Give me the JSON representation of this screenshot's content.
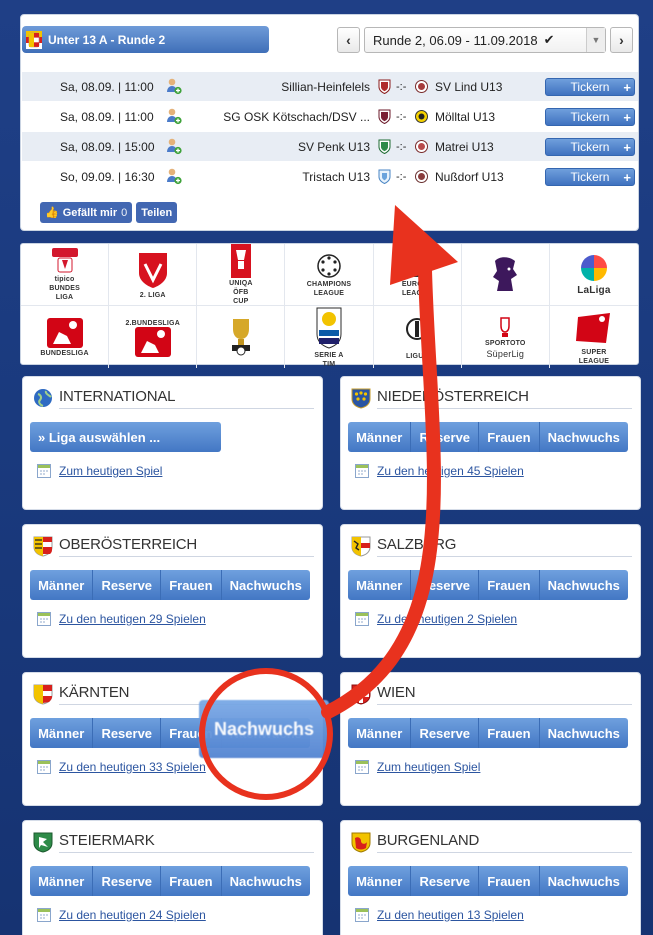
{
  "match_panel": {
    "league_title": "Unter 13 A - Runde 2",
    "round_label": "Runde 2, 06.09 - 11.09.2018",
    "prev_label": "‹",
    "next_label": "›",
    "matches": [
      {
        "date": "Sa, 08.09. | 11:00",
        "home": "Sillian-Heinfelels",
        "score": "-:-",
        "away": "SV Lind U13",
        "ticker": "Tickern"
      },
      {
        "date": "Sa, 08.09. | 11:00",
        "home": "SG OSK Kötschach/DSV ...",
        "score": "-:-",
        "away": "Mölltal U13",
        "ticker": "Tickern"
      },
      {
        "date": "Sa, 08.09. | 15:00",
        "home": "SV Penk U13",
        "score": "-:-",
        "away": "Matrei U13",
        "ticker": "Tickern"
      },
      {
        "date": "So, 09.09. | 16:30",
        "home": "Tristach U13",
        "score": "-:-",
        "away": "Nußdorf U13",
        "ticker": "Tickern"
      }
    ],
    "fb_like": "Gefällt mir",
    "fb_count": "0",
    "fb_share": "Teilen"
  },
  "logos": [
    {
      "name": "tipico-bundesliga-logo",
      "lines": [
        "tipico",
        "BUNDES",
        "LIGA"
      ]
    },
    {
      "name": "2-liga-logo",
      "lines": [
        "2. LIGA"
      ]
    },
    {
      "name": "uniqa-oefb-cup-logo",
      "lines": [
        "UNIQA",
        "ÖFB",
        "CUP"
      ]
    },
    {
      "name": "champions-league-logo",
      "lines": [
        "CHAMPIONS",
        "LEAGUE"
      ]
    },
    {
      "name": "europa-league-logo",
      "lines": [
        "EUROPA",
        "LEAGUE"
      ]
    },
    {
      "name": "premier-league-logo",
      "lines": []
    },
    {
      "name": "laliga-logo",
      "lines": [
        "LaLiga"
      ]
    },
    {
      "name": "bundesliga-logo",
      "lines": [
        "BUNDESLIGA"
      ]
    },
    {
      "name": "2-bundesliga-logo",
      "lines": [
        "2.BUNDESLIGA"
      ]
    },
    {
      "name": "dfb-pokal-logo",
      "lines": []
    },
    {
      "name": "serie-a-logo",
      "lines": [
        "SERIE A",
        "TIM"
      ]
    },
    {
      "name": "ligue-1-logo",
      "lines": [
        "LIGUE"
      ]
    },
    {
      "name": "spor-toto-super-lig-logo",
      "lines": [
        "SPORTOTO",
        "SüperLig"
      ]
    },
    {
      "name": "swiss-super-league-logo",
      "lines": [
        "SUPER",
        "LEAGUE"
      ]
    }
  ],
  "regions": {
    "international": {
      "title": "INTERNATIONAL",
      "select": "» Liga auswählen ...",
      "link": "Zum heutigen Spiel"
    },
    "niederoesterreich": {
      "title": "NIEDERÖSTERREICH",
      "link": "Zu den heutigen 45 Spielen"
    },
    "oberoesterreich": {
      "title": "OBERÖSTERREICH",
      "link": "Zu den heutigen 29 Spielen"
    },
    "salzburg": {
      "title": "SALZBURG",
      "link": "Zu den heutigen 2 Spielen"
    },
    "kaernten": {
      "title": "KÄRNTEN",
      "link": "Zu den heutigen 33 Spielen"
    },
    "wien": {
      "title": "WIEN",
      "link": "Zum heutigen Spiel"
    },
    "steiermark": {
      "title": "STEIERMARK",
      "link": "Zu den heutigen 24 Spielen"
    },
    "burgenland": {
      "title": "BURGENLAND",
      "link": "Zu den heutigen 13 Spielen"
    }
  },
  "tabs": {
    "maenner": "Männer",
    "reserve": "Reserve",
    "frauen": "Frauen",
    "nachwuchs": "Nachwuchs"
  },
  "annotation": {
    "zoom_label": "Nachwuchs"
  },
  "colors": {
    "accent": "#4377c4",
    "annotation": "#e8321e",
    "background": "#1f3f86"
  }
}
